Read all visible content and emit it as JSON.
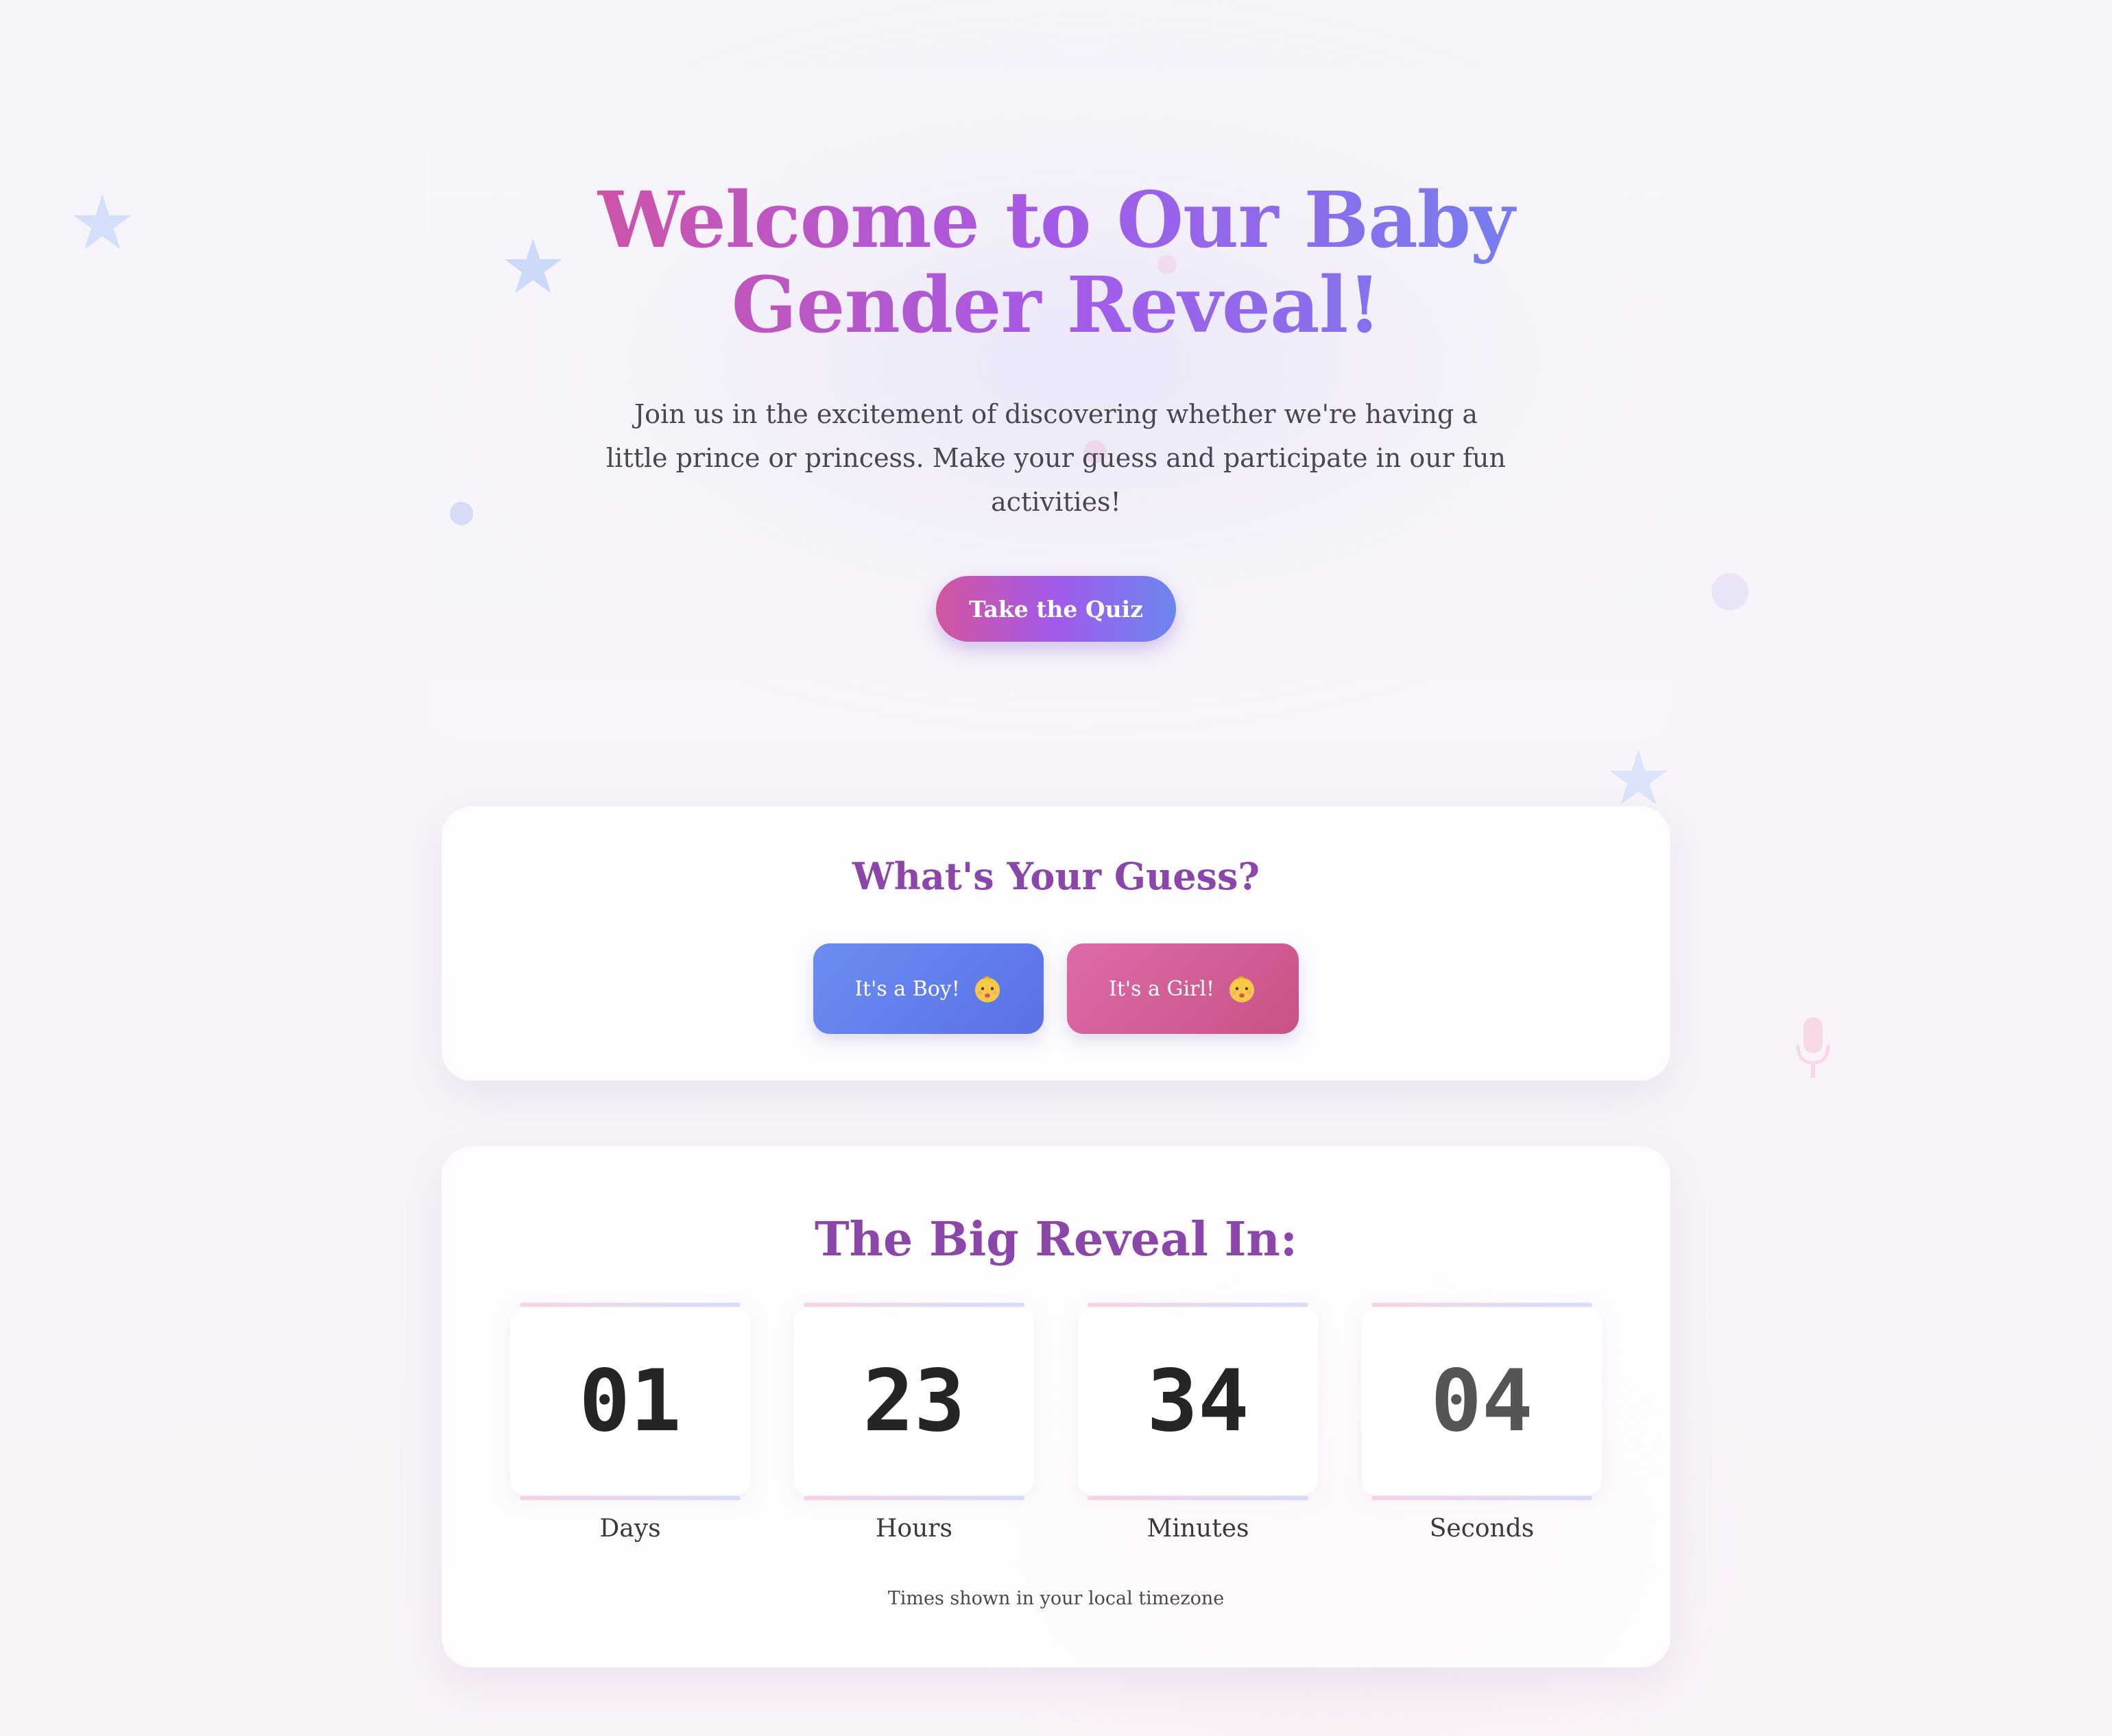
{
  "hero": {
    "title": "Welcome to Our Baby Gender Reveal!",
    "subtitle": "Join us in the excitement of discovering whether we're having a little prince or princess. Make your guess and participate in our fun activities!",
    "cta_label": "Take the Quiz"
  },
  "guess": {
    "title": "What's Your Guess?",
    "boy_label": "It's a Boy!",
    "girl_label": "It's a Girl!",
    "icon": "baby-face-icon"
  },
  "countdown": {
    "title": "The Big Reveal In:",
    "days": {
      "value": "01",
      "label": "Days"
    },
    "hours": {
      "value": "23",
      "label": "Hours"
    },
    "minutes": {
      "value": "34",
      "label": "Minutes"
    },
    "seconds": {
      "value": "04",
      "label": "Seconds"
    },
    "note": "Times shown in your local timezone"
  },
  "colors": {
    "gradient_pink": "#d4539c",
    "gradient_purple": "#a45ae8",
    "gradient_blue": "#6d84f0",
    "boy_button": "#6b8ef2",
    "girl_button": "#dd6ba8",
    "heading_purple": "#8a46a8"
  }
}
